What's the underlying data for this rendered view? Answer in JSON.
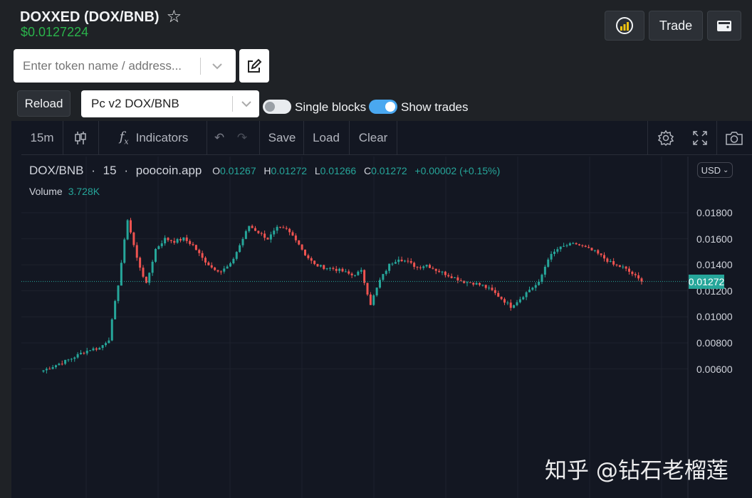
{
  "header": {
    "token_title": "DOXXED (DOX/BNB)",
    "price": "$0.0127224",
    "trade_label": "Trade"
  },
  "search": {
    "placeholder": "Enter token name / address..."
  },
  "controls": {
    "reload_label": "Reload",
    "pair_select": "Pc v2 DOX/BNB",
    "single_blocks_label": "Single blocks",
    "single_blocks_on": false,
    "show_trades_label": "Show trades",
    "show_trades_on": true
  },
  "toolbar": {
    "interval": "15m",
    "indicators_label": "Indicators",
    "save_label": "Save",
    "load_label": "Load",
    "clear_label": "Clear"
  },
  "legend": {
    "symbol": "DOX/BNB",
    "interval": "15",
    "source": "poocoin.app",
    "o_key": "O",
    "o_val": "0.01267",
    "h_key": "H",
    "h_val": "0.01272",
    "l_key": "L",
    "l_val": "0.01266",
    "c_key": "C",
    "c_val": "0.01272",
    "change": "+0.00002 (+0.15%)",
    "volume_label": "Volume",
    "volume_val": "3.728K"
  },
  "currency": "USD",
  "last_price_label": "0.01272",
  "watermark": "知乎 @钻石老榴莲",
  "colors": {
    "up": "#26a69a",
    "down": "#ef5350",
    "price_green": "#2bb34b",
    "toggle_on": "#4aa8f0"
  },
  "chart_data": {
    "type": "line",
    "subtype": "candlestick",
    "title": "DOX/BNB · 15 · poocoin.app",
    "y_tick_labels": [
      "0.01800",
      "0.01600",
      "0.01400",
      "0.01200",
      "0.01000",
      "0.00800",
      "0.00600"
    ],
    "ylim": [
      0.0055,
      0.0195
    ],
    "last_price": 0.01272,
    "grid": true,
    "series": [
      {
        "values": [
          0.0059,
          0.0062,
          0.0065,
          0.0068,
          0.0072,
          0.0075,
          0.0076,
          0.0083,
          0.0125,
          0.0175,
          0.0145,
          0.0125,
          0.0152,
          0.016,
          0.0158,
          0.016,
          0.0155,
          0.0145,
          0.0138,
          0.0135,
          0.014,
          0.0155,
          0.017,
          0.0165,
          0.016,
          0.0168,
          0.0167,
          0.016,
          0.0148,
          0.014,
          0.0138,
          0.0137,
          0.0135,
          0.0132,
          0.0135,
          0.011,
          0.0128,
          0.014,
          0.0145,
          0.0142,
          0.0138,
          0.014,
          0.0136,
          0.0133,
          0.013,
          0.0127,
          0.0126,
          0.0124,
          0.012,
          0.0114,
          0.0108,
          0.0114,
          0.0121,
          0.0126,
          0.0145,
          0.0152,
          0.0155,
          0.0156,
          0.0153,
          0.015,
          0.0145,
          0.014,
          0.0138,
          0.0133,
          0.0127
        ]
      }
    ]
  }
}
